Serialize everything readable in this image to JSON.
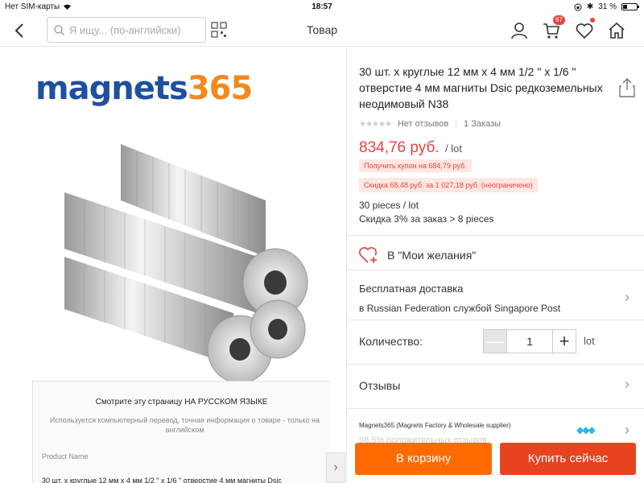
{
  "status_bar": {
    "carrier": "Нет SIM-карты",
    "time": "18:57",
    "battery": "31 %"
  },
  "nav": {
    "search_placeholder": "Я ищу... (по-английски)",
    "title": "Товар",
    "cart_badge": "67"
  },
  "gallery": {
    "logo_part1": "magnets",
    "logo_part2": "365"
  },
  "translate_notice": {
    "title": "Смотрите эту страницу НА РУССКОМ ЯЗЫКЕ",
    "subtitle": "Используется компьютерный перевод, точная информация о товаре - только на английском"
  },
  "product_name": {
    "label": "Product Name",
    "value": "30 шт. x круглые 12 мм x 4 мм 1/2 \" x 1/6 \" отверстие 4 мм магниты Dsic"
  },
  "product": {
    "title": "30 шт. x круглые 12 мм x 4 мм 1/2 \" x 1/6 \" отверстие 4 мм магниты Dsic редкоземельных неодимовый N38",
    "reviews_count": "Нет отзывов",
    "orders": "1 Заказы",
    "price": "834,76 руб.",
    "per_lot": "/ lot",
    "coupon": "Получить купон на 684,79 руб.",
    "discount": "Скидка 68,48 руб. за 1 027,18 руб. (неограничено)",
    "pieces": "30 pieces / lot",
    "bulk": "Скидка 3% за заказ > 8 pieces"
  },
  "wishlist": {
    "label": "В \"Мои желания\""
  },
  "shipping": {
    "title": "Бесплатная доставка",
    "detail": "в Russian Federation службой Singapore Post"
  },
  "quantity": {
    "label": "Количество:",
    "value": "1",
    "unit": "lot",
    "minus": "—",
    "plus": "+"
  },
  "reviews": {
    "label": "Отзывы"
  },
  "seller": {
    "name": "Magnets365 (Magnets Factory & Wholesale supplier)",
    "feedback": "98.5% положительных отзывов"
  },
  "actions": {
    "add_to_cart": "В корзину",
    "buy_now": "Купить сейчас"
  },
  "colors": {
    "accent": "#e64340",
    "cart_button": "#ff6a00",
    "buy_button": "#e8431f"
  },
  "icons": [
    "back-icon",
    "search-icon",
    "qr-scan-icon",
    "user-icon",
    "cart-icon",
    "heart-icon",
    "home-icon",
    "share-icon",
    "wishlist-heart-icon",
    "chevron-right-icon",
    "diamond-icon"
  ]
}
